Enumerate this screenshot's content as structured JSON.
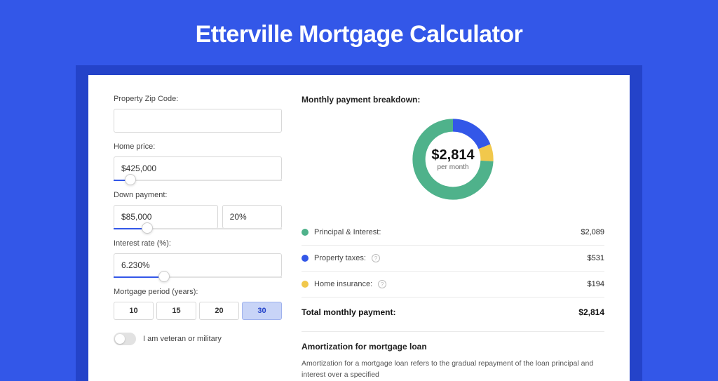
{
  "page": {
    "title": "Etterville Mortgage Calculator"
  },
  "form": {
    "zip_label": "Property Zip Code:",
    "zip_value": "",
    "home_price_label": "Home price:",
    "home_price_value": "$425,000",
    "home_price_slider_pct": 10,
    "down_payment_label": "Down payment:",
    "down_payment_value": "$85,000",
    "down_payment_pct": "20%",
    "down_payment_slider_pct": 20,
    "interest_label": "Interest rate (%):",
    "interest_value": "6.230%",
    "interest_slider_pct": 30,
    "period_label": "Mortgage period (years):",
    "period_options": [
      "10",
      "15",
      "20",
      "30"
    ],
    "period_selected": "30",
    "veteran_label": "I am veteran or military",
    "veteran_on": false
  },
  "breakdown": {
    "title": "Monthly payment breakdown:",
    "center_amount": "$2,814",
    "center_sub": "per month",
    "items": [
      {
        "label": "Principal & Interest:",
        "value": "$2,089",
        "color": "#4fb28b",
        "info": false
      },
      {
        "label": "Property taxes:",
        "value": "$531",
        "color": "#3357e8",
        "info": true
      },
      {
        "label": "Home insurance:",
        "value": "$194",
        "color": "#f1c84c",
        "info": true
      }
    ],
    "total_label": "Total monthly payment:",
    "total_value": "$2,814"
  },
  "chart_data": {
    "type": "pie",
    "title": "Monthly payment breakdown",
    "series": [
      {
        "name": "Principal & Interest",
        "value": 2089,
        "color": "#4fb28b"
      },
      {
        "name": "Property taxes",
        "value": 531,
        "color": "#3357e8"
      },
      {
        "name": "Home insurance",
        "value": 194,
        "color": "#f1c84c"
      }
    ],
    "total": 2814,
    "center_label": "$2,814 per month"
  },
  "amortization": {
    "title": "Amortization for mortgage loan",
    "text": "Amortization for a mortgage loan refers to the gradual repayment of the loan principal and interest over a specified"
  }
}
